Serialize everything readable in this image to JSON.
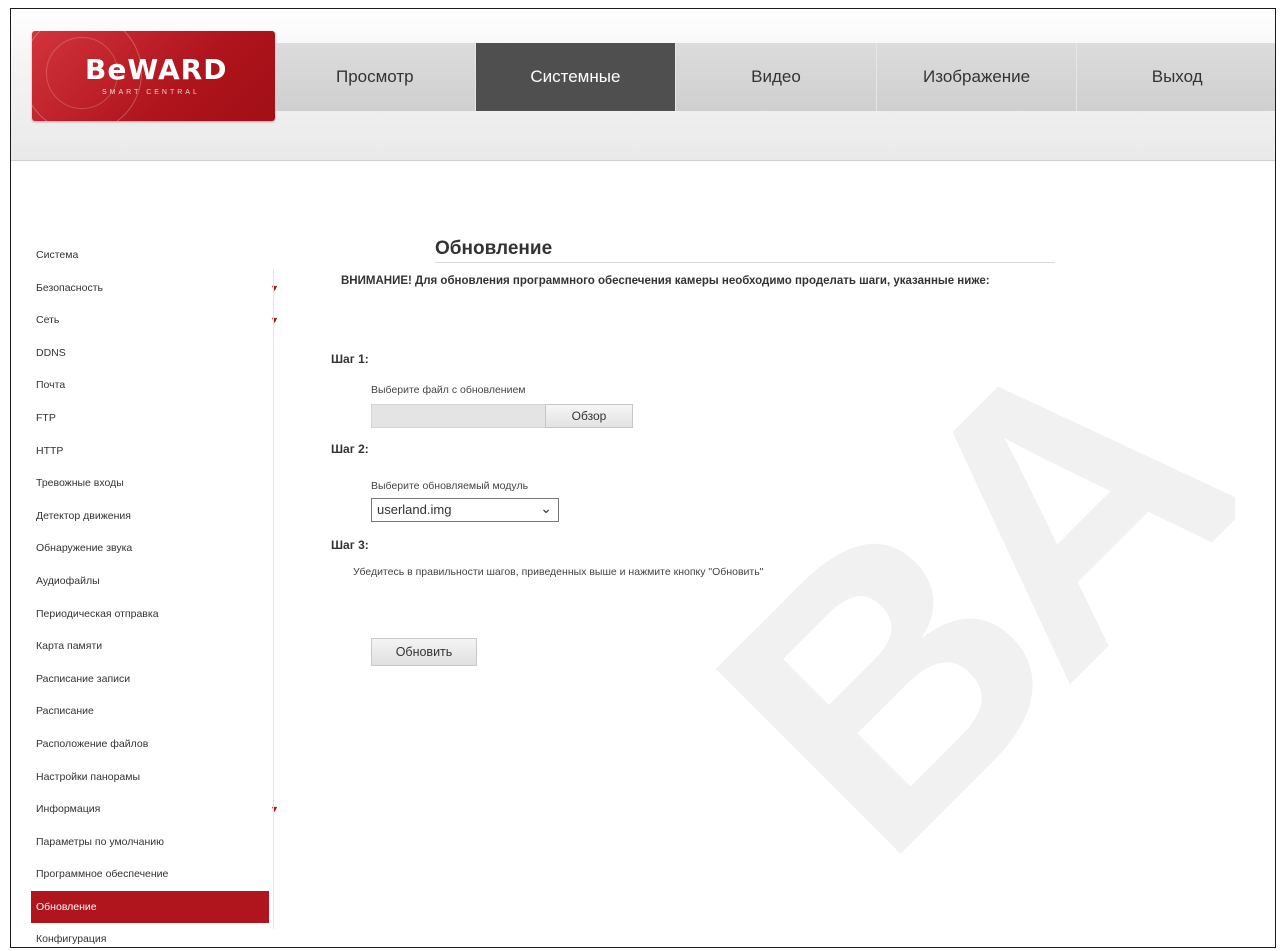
{
  "logo": {
    "text": "BeWARD",
    "sub": "SMART CENTRAL"
  },
  "nav": {
    "tabs": [
      "Просмотр",
      "Системные",
      "Видео",
      "Изображение",
      "Выход"
    ],
    "active_index": 1
  },
  "sidebar": {
    "items": [
      {
        "label": "Система",
        "arrow": false
      },
      {
        "label": "Безопасность",
        "arrow": true
      },
      {
        "label": "Сеть",
        "arrow": true
      },
      {
        "label": "DDNS",
        "arrow": false
      },
      {
        "label": "Почта",
        "arrow": false
      },
      {
        "label": "FTP",
        "arrow": false
      },
      {
        "label": "HTTP",
        "arrow": false
      },
      {
        "label": "Тревожные входы",
        "arrow": false
      },
      {
        "label": "Детектор движения",
        "arrow": false
      },
      {
        "label": "Обнаружение звука",
        "arrow": false
      },
      {
        "label": "Аудиофайлы",
        "arrow": false
      },
      {
        "label": "Периодическая отправка",
        "arrow": false
      },
      {
        "label": "Карта памяти",
        "arrow": false
      },
      {
        "label": "Расписание записи",
        "arrow": false
      },
      {
        "label": "Расписание",
        "arrow": false
      },
      {
        "label": "Расположение файлов",
        "arrow": false
      },
      {
        "label": "Настройки панорамы",
        "arrow": false
      },
      {
        "label": "Информация",
        "arrow": true
      },
      {
        "label": "Параметры по умолчанию",
        "arrow": false
      },
      {
        "label": "Программное обеспечение",
        "arrow": false
      },
      {
        "label": "Обновление",
        "arrow": false
      },
      {
        "label": "Конфигурация",
        "arrow": false
      }
    ],
    "active_index": 20
  },
  "main": {
    "title": "Обновление",
    "warning": "ВНИМАНИЕ! Для обновления программного обеспечения камеры необходимо проделать шаги, указанные ниже:",
    "step1": {
      "label": "Шаг 1:",
      "hint": "Выберите файл с обновлением",
      "browse": "Обзор"
    },
    "step2": {
      "label": "Шаг 2:",
      "hint": "Выберите обновляемый модуль",
      "selected": "userland.img"
    },
    "step3": {
      "label": "Шаг 3:",
      "hint": "Убедитесь в правильности шагов, приведенных выше и нажмите кнопку \"Обновить\""
    },
    "update_button": "Обновить"
  },
  "colors": {
    "accent": "#b0141c",
    "nav_active": "#4f4f4f"
  }
}
